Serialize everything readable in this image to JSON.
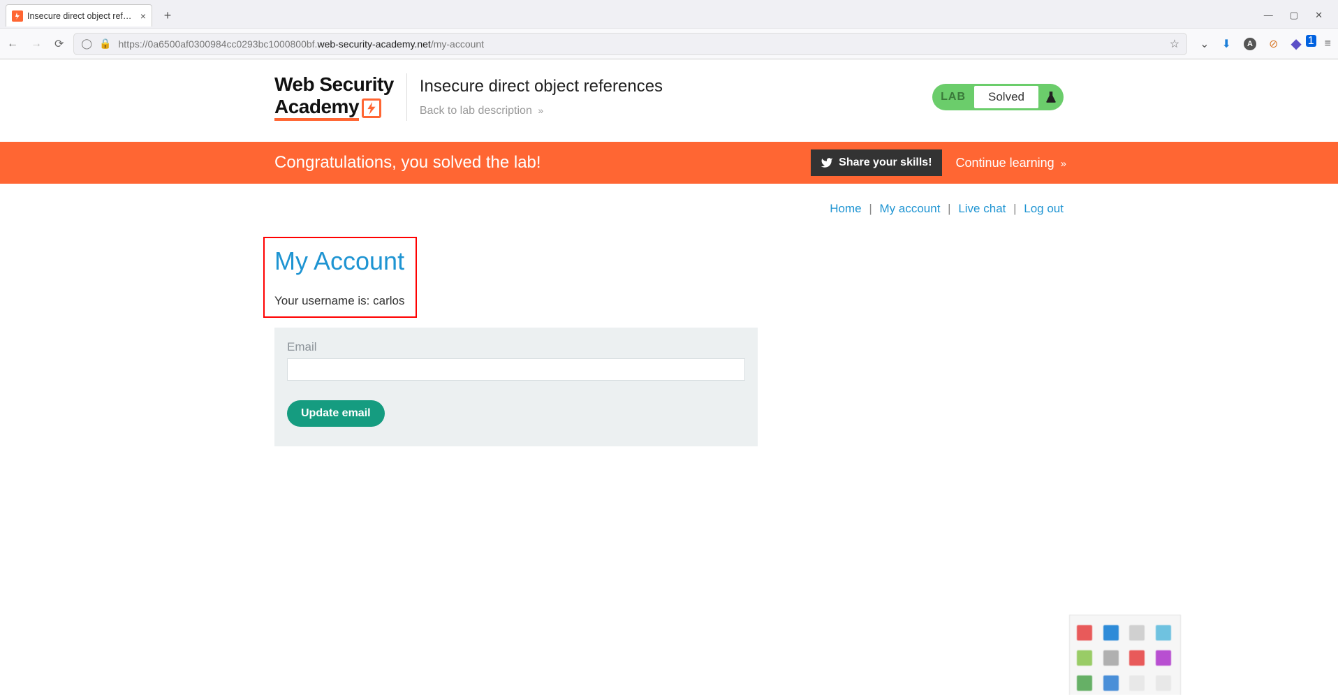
{
  "browser": {
    "tab_title": "Insecure direct object references",
    "url_prefix": "https://",
    "url_host_light1": "0a6500af0300984cc0293bc1000800bf.",
    "url_host_dark": "web-security-academy.net",
    "url_path": "/my-account",
    "ext_badge": "1"
  },
  "header": {
    "logo_line1": "Web Security",
    "logo_line2": "Academy",
    "lab_title": "Insecure direct object references",
    "back_link": "Back to lab description",
    "pill_lab": "LAB",
    "pill_status": "Solved"
  },
  "congrats": {
    "message": "Congratulations, you solved the lab!",
    "share_label": "Share your skills!",
    "continue_label": "Continue learning"
  },
  "nav": {
    "home": "Home",
    "account": "My account",
    "chat": "Live chat",
    "logout": "Log out",
    "sep": "|"
  },
  "account": {
    "title": "My Account",
    "username_label": "Your username is: ",
    "username_value": "carlos",
    "email_label": "Email",
    "update_btn": "Update email"
  },
  "tiles": {
    "colors": [
      "#e85a5a",
      "#2e8bd8",
      "#d0d0d0",
      "#6fc2e0",
      "#99cc66",
      "#b0b0b0",
      "#e85a5a",
      "#b84fd1",
      "#66b066",
      "#4a8fd8",
      "#e8e8e8",
      "#e8e8e8"
    ]
  }
}
